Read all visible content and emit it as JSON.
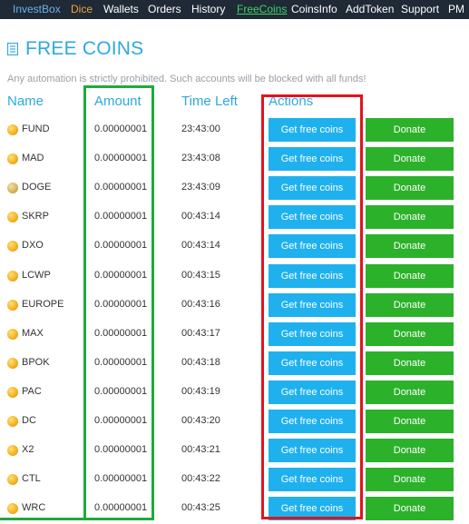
{
  "nav": {
    "items": [
      {
        "label": "InvestBox",
        "color": "#6fb0e6"
      },
      {
        "label": "Dice",
        "color": "#f0a040"
      },
      {
        "label": "Wallets",
        "color": "#ffffff"
      },
      {
        "label": "Orders",
        "color": "#ffffff"
      },
      {
        "label": "History",
        "color": "#ffffff"
      },
      {
        "label": "FreeCoins",
        "color": "#3fd06a",
        "active": true
      },
      {
        "label": "CoinsInfo",
        "color": "#ffffff"
      },
      {
        "label": "AddToken",
        "color": "#ffffff"
      },
      {
        "label": "Support",
        "color": "#ffffff"
      },
      {
        "label": "PM",
        "color": "#ffffff"
      }
    ]
  },
  "page": {
    "title": "FREE COINS",
    "icon": "document-icon",
    "notice": "Any automation is strictly prohibited. Such accounts will be blocked with all funds!"
  },
  "table": {
    "headers": {
      "name": "Name",
      "amount": "Amount",
      "time_left": "Time Left",
      "actions": "Actions"
    },
    "get_label": "Get free coins",
    "donate_label": "Donate",
    "rows": [
      {
        "name": "FUND",
        "amount": "0.00000001",
        "time": "23:43:00",
        "icon": "coin-icon"
      },
      {
        "name": "MAD",
        "amount": "0.00000001",
        "time": "23:43:08",
        "icon": "coin-icon"
      },
      {
        "name": "DOGE",
        "amount": "0.00000001",
        "time": "23:43:09",
        "icon": "doge-icon"
      },
      {
        "name": "SKRP",
        "amount": "0.00000001",
        "time": "00:43:14",
        "icon": "coin-icon"
      },
      {
        "name": "DXO",
        "amount": "0.00000001",
        "time": "00:43:14",
        "icon": "coin-icon"
      },
      {
        "name": "LCWP",
        "amount": "0.00000001",
        "time": "00:43:15",
        "icon": "coin-icon"
      },
      {
        "name": "EUROPE",
        "amount": "0.00000001",
        "time": "00:43:16",
        "icon": "coin-icon"
      },
      {
        "name": "MAX",
        "amount": "0.00000001",
        "time": "00:43:17",
        "icon": "coin-icon"
      },
      {
        "name": "BPOK",
        "amount": "0.00000001",
        "time": "00:43:18",
        "icon": "coin-icon"
      },
      {
        "name": "PAC",
        "amount": "0.00000001",
        "time": "00:43:19",
        "icon": "coin-icon"
      },
      {
        "name": "DC",
        "amount": "0.00000001",
        "time": "00:43:20",
        "icon": "coin-icon"
      },
      {
        "name": "X2",
        "amount": "0.00000001",
        "time": "00:43:21",
        "icon": "coin-icon"
      },
      {
        "name": "CTL",
        "amount": "0.00000001",
        "time": "00:43:22",
        "icon": "coin-icon"
      },
      {
        "name": "WRC",
        "amount": "0.00000001",
        "time": "00:43:25",
        "icon": "coin-icon"
      }
    ]
  },
  "colors": {
    "accent": "#2fa8e0",
    "nav_bg": "#1f2a36",
    "get_button": "#1fb1ee",
    "donate_button": "#2cb12b",
    "highlight_green": "#1faa3c",
    "highlight_red": "#e0141e"
  }
}
